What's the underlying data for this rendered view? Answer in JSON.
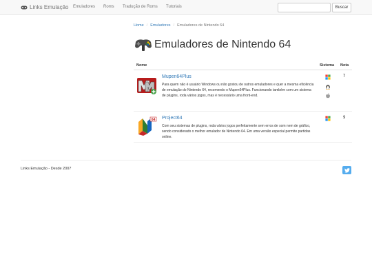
{
  "brand": {
    "name": "Links Emulação",
    "icon": "gamepad-icon"
  },
  "nav": {
    "items": [
      {
        "label": "Emuladores"
      },
      {
        "label": "Roms"
      },
      {
        "label": "Tradução de Roms"
      },
      {
        "label": "Tutoriais"
      }
    ],
    "search_value": "",
    "search_button": "Buscar"
  },
  "breadcrumb": {
    "home": "Home",
    "section": "Emuladores",
    "current": "Emuladores de Nintendo 64"
  },
  "page": {
    "title": "Emuladores de Nintendo 64",
    "icon": "n64-controller-icon"
  },
  "table": {
    "headers": {
      "name": "Nome",
      "system": "Sistema",
      "score": "Nota"
    },
    "rows": [
      {
        "name": "Mupen64Plus",
        "description": "Para quem não é usuário Windows ou não gostou de outros emuladores e quer a mesma eficiência de emulação do Nintendo 64, recomendo o Mupen64Plus. Funcionando também com um sistema de plugins, roda vários jogos, mas é necessário uma front-end.",
        "systems": [
          "windows-icon",
          "linux-icon",
          "mac-icon"
        ],
        "score": "7"
      },
      {
        "name": "Project64",
        "description": "Com seu sistemas de plugins, roda vários jogos perfeitamente sem erros de som nem de gráfico, sendo considerado o melhor emulador de Nintendo 64. Em uma versão especial permite partidas online.",
        "systems": [
          "windows-icon"
        ],
        "score": "9"
      }
    ]
  },
  "footer": {
    "text": "Links Emulação - Desde 2007",
    "social_icon": "twitter-icon"
  },
  "colors": {
    "link": "#337ab7",
    "twitter": "#55acee",
    "navbar": "#f8f8f8"
  }
}
